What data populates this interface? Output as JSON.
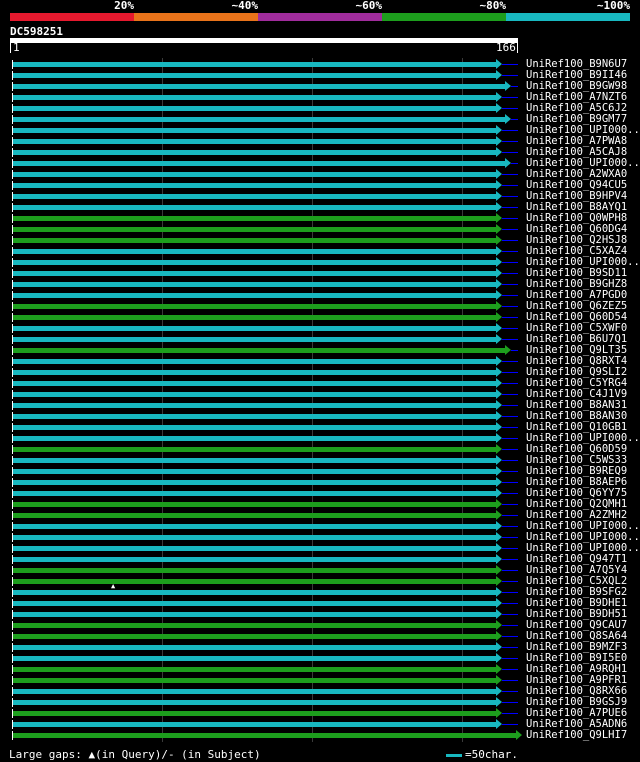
{
  "scale": {
    "labels": [
      "20%",
      "~40%",
      "~60%",
      "~80%",
      "~100%"
    ],
    "colors": [
      "#e6192e",
      "#e8731a",
      "#a02c9c",
      "#1d9e1d",
      "#18b8c0"
    ]
  },
  "query": {
    "id": "DC598251",
    "start": "1",
    "end": "166"
  },
  "hits": [
    {
      "label": "UniRef100_B9N6U7",
      "color": "#18b8c0",
      "end": 496
    },
    {
      "label": "UniRef100_B9II46",
      "color": "#18b8c0",
      "end": 496
    },
    {
      "label": "UniRef100_B9GW98",
      "color": "#18b8c0",
      "end": 505
    },
    {
      "label": "UniRef100_A7NZT6",
      "color": "#18b8c0",
      "end": 496
    },
    {
      "label": "UniRef100_A5C6J2",
      "color": "#18b8c0",
      "end": 496
    },
    {
      "label": "UniRef100_B9GM77",
      "color": "#18b8c0",
      "end": 505
    },
    {
      "label": "UniRef100_UPI000..",
      "color": "#18b8c0",
      "end": 496
    },
    {
      "label": "UniRef100_A7PWA8",
      "color": "#18b8c0",
      "end": 496
    },
    {
      "label": "UniRef100_A5CAJ8",
      "color": "#18b8c0",
      "end": 496
    },
    {
      "label": "UniRef100_UPI000..",
      "color": "#18b8c0",
      "end": 505
    },
    {
      "label": "UniRef100_A2WXA0",
      "color": "#18b8c0",
      "end": 496
    },
    {
      "label": "UniRef100_Q94CU5",
      "color": "#18b8c0",
      "end": 496
    },
    {
      "label": "UniRef100_B9HPV4",
      "color": "#18b8c0",
      "end": 496
    },
    {
      "label": "UniRef100_B8AYQ1",
      "color": "#18b8c0",
      "end": 496
    },
    {
      "label": "UniRef100_Q0WPH8",
      "color": "#1d9e1d",
      "end": 496
    },
    {
      "label": "UniRef100_Q60DG4",
      "color": "#1d9e1d",
      "end": 496
    },
    {
      "label": "UniRef100_Q2HSJ8",
      "color": "#1d9e1d",
      "end": 496
    },
    {
      "label": "UniRef100_C5XAZ4",
      "color": "#18b8c0",
      "end": 496
    },
    {
      "label": "UniRef100_UPI000..",
      "color": "#18b8c0",
      "end": 496
    },
    {
      "label": "UniRef100_B9SD11",
      "color": "#18b8c0",
      "end": 496
    },
    {
      "label": "UniRef100_B9GHZ8",
      "color": "#18b8c0",
      "end": 496
    },
    {
      "label": "UniRef100_A7PGD0",
      "color": "#18b8c0",
      "end": 496
    },
    {
      "label": "UniRef100_Q6ZEZ5",
      "color": "#1d9e1d",
      "end": 496
    },
    {
      "label": "UniRef100_Q60D54",
      "color": "#1d9e1d",
      "end": 496
    },
    {
      "label": "UniRef100_C5XWF0",
      "color": "#18b8c0",
      "end": 496
    },
    {
      "label": "UniRef100_B6U7Q1",
      "color": "#18b8c0",
      "end": 496
    },
    {
      "label": "UniRef100_Q9LT35",
      "color": "#1d9e1d",
      "end": 505
    },
    {
      "label": "UniRef100_Q8RXT4",
      "color": "#18b8c0",
      "end": 496
    },
    {
      "label": "UniRef100_Q9SLI2",
      "color": "#18b8c0",
      "end": 496
    },
    {
      "label": "UniRef100_C5YRG4",
      "color": "#18b8c0",
      "end": 496
    },
    {
      "label": "UniRef100_C4J1V9",
      "color": "#18b8c0",
      "end": 496
    },
    {
      "label": "UniRef100_B8AN31",
      "color": "#18b8c0",
      "end": 496
    },
    {
      "label": "UniRef100_B8AN30",
      "color": "#18b8c0",
      "end": 496
    },
    {
      "label": "UniRef100_Q10GB1",
      "color": "#18b8c0",
      "end": 496
    },
    {
      "label": "UniRef100_UPI000..",
      "color": "#18b8c0",
      "end": 496
    },
    {
      "label": "UniRef100_Q60D59",
      "color": "#1d9e1d",
      "end": 496
    },
    {
      "label": "UniRef100_C5WS33",
      "color": "#18b8c0",
      "end": 496
    },
    {
      "label": "UniRef100_B9REQ9",
      "color": "#18b8c0",
      "end": 496
    },
    {
      "label": "UniRef100_B8AEP6",
      "color": "#18b8c0",
      "end": 496
    },
    {
      "label": "UniRef100_Q6YY75",
      "color": "#18b8c0",
      "end": 496
    },
    {
      "label": "UniRef100_Q2QMH1",
      "color": "#1d9e1d",
      "end": 496
    },
    {
      "label": "UniRef100_A2ZMH2",
      "color": "#1d9e1d",
      "end": 496
    },
    {
      "label": "UniRef100_UPI000..",
      "color": "#18b8c0",
      "end": 496
    },
    {
      "label": "UniRef100_UPI000..",
      "color": "#18b8c0",
      "end": 496
    },
    {
      "label": "UniRef100_UPI000..",
      "color": "#18b8c0",
      "end": 496
    },
    {
      "label": "UniRef100_Q947T1",
      "color": "#18b8c0",
      "end": 496
    },
    {
      "label": "UniRef100_A7Q5Y4",
      "color": "#1d9e1d",
      "end": 496
    },
    {
      "label": "UniRef100_C5XQL2",
      "color": "#1d9e1d",
      "end": 496
    },
    {
      "label": "UniRef100_B9SFG2",
      "color": "#18b8c0",
      "end": 496
    },
    {
      "label": "UniRef100_B9DHE1",
      "color": "#18b8c0",
      "end": 496
    },
    {
      "label": "UniRef100_B9DH51",
      "color": "#18b8c0",
      "end": 496
    },
    {
      "label": "UniRef100_Q9CAU7",
      "color": "#1d9e1d",
      "end": 496
    },
    {
      "label": "UniRef100_Q8SA64",
      "color": "#1d9e1d",
      "end": 496
    },
    {
      "label": "UniRef100_B9MZF3",
      "color": "#18b8c0",
      "end": 496
    },
    {
      "label": "UniRef100_B9I5E0",
      "color": "#18b8c0",
      "end": 496
    },
    {
      "label": "UniRef100_A9RQH1",
      "color": "#1d9e1d",
      "end": 496
    },
    {
      "label": "UniRef100_A9PFR1",
      "color": "#1d9e1d",
      "end": 496
    },
    {
      "label": "UniRef100_Q8RX66",
      "color": "#18b8c0",
      "end": 496
    },
    {
      "label": "UniRef100_B9GSJ9",
      "color": "#18b8c0",
      "end": 496
    },
    {
      "label": "UniRef100_A7PUE6",
      "color": "#1d9e1d",
      "end": 496
    },
    {
      "label": "UniRef100_A5ADN6",
      "color": "#18b8c0",
      "end": 496
    },
    {
      "label": "UniRef100_Q9LHI7",
      "color": "#1d9e1d",
      "end": 516
    }
  ],
  "legend": {
    "text": "Large gaps: ▲(in Query)/- (in Subject)",
    "unit": "=50char."
  },
  "gap_marker": "▲"
}
